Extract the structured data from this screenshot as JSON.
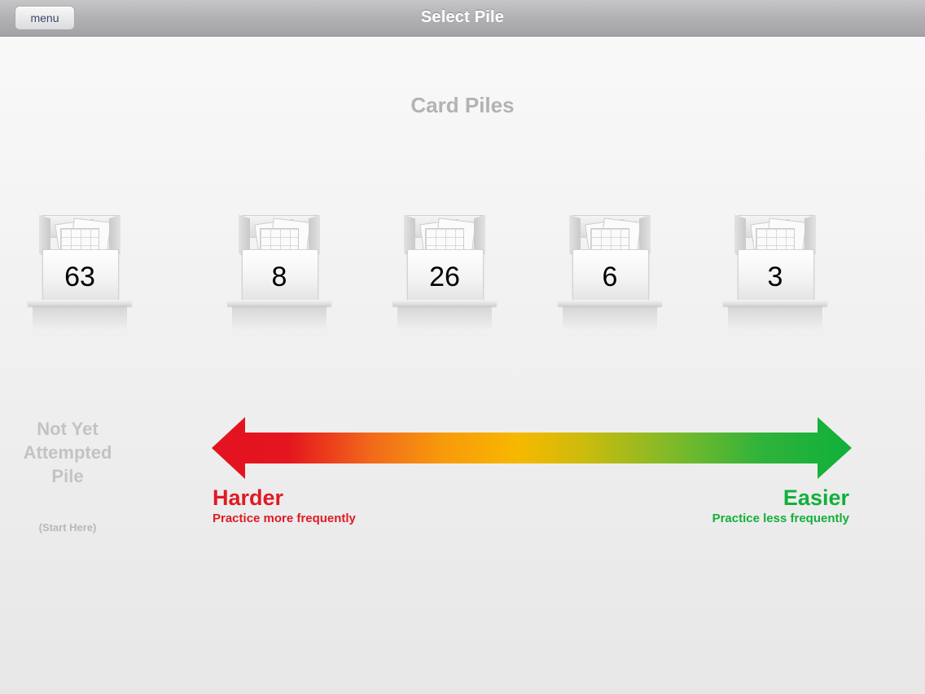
{
  "navbar": {
    "title": "Select Pile",
    "menu_label": "menu"
  },
  "section_title": "Card Piles",
  "piles": [
    {
      "count": "63",
      "icon": "card-box-icon"
    },
    {
      "count": "8",
      "icon": "card-box-icon"
    },
    {
      "count": "26",
      "icon": "card-box-icon"
    },
    {
      "count": "6",
      "icon": "card-box-icon"
    },
    {
      "count": "3",
      "icon": "card-box-icon"
    }
  ],
  "not_attempted": {
    "line1": "Not Yet",
    "line2": "Attempted",
    "line3": "Pile",
    "hint": "(Start Here)"
  },
  "scale": {
    "left_label": "Harder",
    "left_sub": "Practice more frequently",
    "right_label": "Easier",
    "right_sub": "Practice less frequently"
  },
  "colors": {
    "harder": "#e01a24",
    "easier": "#12b03a",
    "gradient_mid": "#f7b500"
  }
}
